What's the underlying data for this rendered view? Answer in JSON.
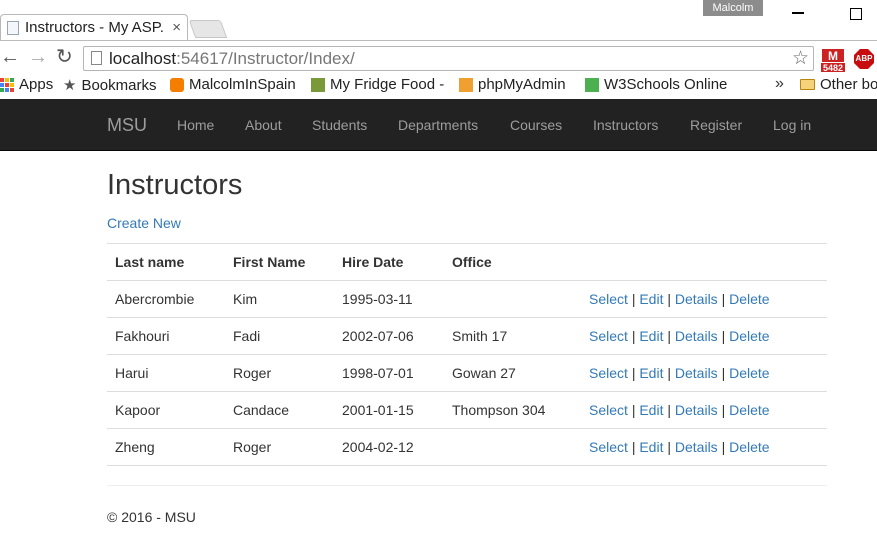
{
  "browser": {
    "tab_title": "Instructors - My ASP.",
    "user": "Malcolm",
    "url_host": "localhost",
    "url_path": ":54617/Instructor/Index/",
    "mail_count": "5482",
    "abp_label": "ABP",
    "bookmarks": [
      {
        "label": "Apps",
        "icon": "apps-icon"
      },
      {
        "label": "Bookmarks",
        "icon": "star-icon"
      },
      {
        "label": "MalcolmInSpain",
        "icon": "blogger-icon"
      },
      {
        "label": "My Fridge Food -",
        "icon": "fridge-icon"
      },
      {
        "label": "phpMyAdmin",
        "icon": "phpmyadmin-icon"
      },
      {
        "label": "W3Schools Online",
        "icon": "w3schools-icon"
      }
    ],
    "other_bookmarks": "Other bo"
  },
  "site": {
    "brand": "MSU",
    "nav": [
      "Home",
      "About",
      "Students",
      "Departments",
      "Courses",
      "Instructors",
      "Register",
      "Log in"
    ]
  },
  "page": {
    "title": "Instructors",
    "create_link": "Create New",
    "columns": [
      "Last name",
      "First Name",
      "Hire Date",
      "Office"
    ],
    "rows": [
      {
        "last": "Abercrombie",
        "first": "Kim",
        "hire": "1995-03-11",
        "office": ""
      },
      {
        "last": "Fakhouri",
        "first": "Fadi",
        "hire": "2002-07-06",
        "office": "Smith 17"
      },
      {
        "last": "Harui",
        "first": "Roger",
        "hire": "1998-07-01",
        "office": "Gowan 27"
      },
      {
        "last": "Kapoor",
        "first": "Candace",
        "hire": "2001-01-15",
        "office": "Thompson 304"
      },
      {
        "last": "Zheng",
        "first": "Roger",
        "hire": "2004-02-12",
        "office": ""
      }
    ],
    "actions": [
      "Select",
      "Edit",
      "Details",
      "Delete"
    ],
    "action_sep": "|",
    "footer": "© 2016 - MSU"
  },
  "colors": {
    "navbar_bg": "#222222",
    "nav_text": "#9d9d9d",
    "link": "#337ab7"
  }
}
